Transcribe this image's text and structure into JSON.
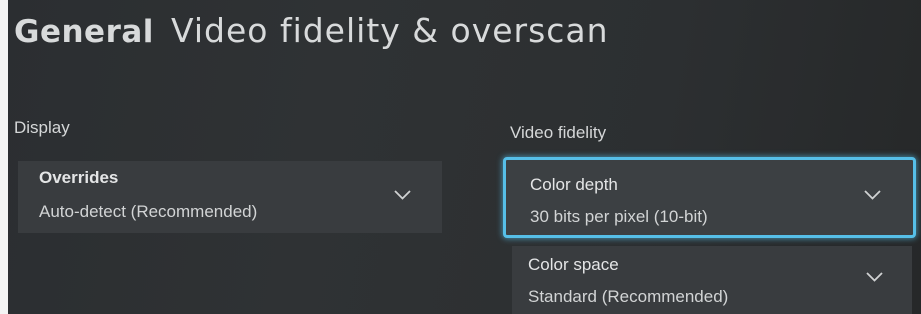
{
  "header": {
    "section": "General",
    "title": "Video fidelity & overscan"
  },
  "display_section": {
    "label": "Display",
    "overrides": {
      "label": "Overrides",
      "value": "Auto-detect (Recommended)",
      "icon": "chevron-down-icon"
    }
  },
  "video_section": {
    "label": "Video fidelity",
    "color_depth": {
      "label": "Color depth",
      "value": "30 bits per pixel (10-bit)",
      "icon": "chevron-down-icon",
      "focused": true
    },
    "color_space": {
      "label": "Color space",
      "value": "Standard (Recommended)",
      "icon": "chevron-down-icon"
    }
  },
  "colors": {
    "background": "#2d3032",
    "panel": "#393c3f",
    "focus_ring": "#56bfe8",
    "text": "#dcdedf"
  }
}
